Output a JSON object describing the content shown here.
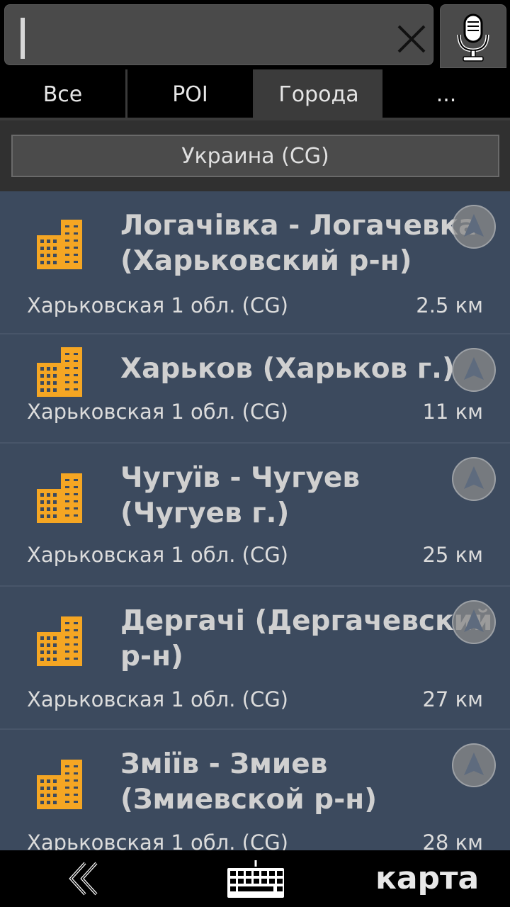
{
  "search": {
    "value": ""
  },
  "tabs": [
    {
      "label": "Все"
    },
    {
      "label": "POI"
    },
    {
      "label": "Города",
      "active": true
    },
    {
      "label": "..."
    }
  ],
  "region": {
    "label": "Украина (CG)"
  },
  "results": [
    {
      "title_line1": "Логачівка - Логачевка",
      "title_line2": "(Харьковский р-н)",
      "subtitle": "Харьковская 1 обл. (CG)",
      "distance": "2.5 км"
    },
    {
      "title_line1": "Харьков (Харьков г.)",
      "title_line2": "",
      "subtitle": "Харьковская 1 обл. (CG)",
      "distance": "11 км"
    },
    {
      "title_line1": "Чугуїв - Чугуев",
      "title_line2": "(Чугуев г.)",
      "subtitle": "Харьковская 1 обл. (CG)",
      "distance": "25 км"
    },
    {
      "title_line1": "Дергачі (Дергачевский",
      "title_line2": "р-н)",
      "subtitle": "Харьковская 1 обл. (CG)",
      "distance": "27 км"
    },
    {
      "title_line1": "Зміїв - Змиев",
      "title_line2": "(Змиевской р-н)",
      "subtitle": "Харьковская 1 обл. (CG)",
      "distance": "28 км"
    }
  ],
  "bottom": {
    "map_label": "карта"
  },
  "colors": {
    "accent_icon": "#f5a623",
    "list_bg": "#3c4a5e"
  }
}
